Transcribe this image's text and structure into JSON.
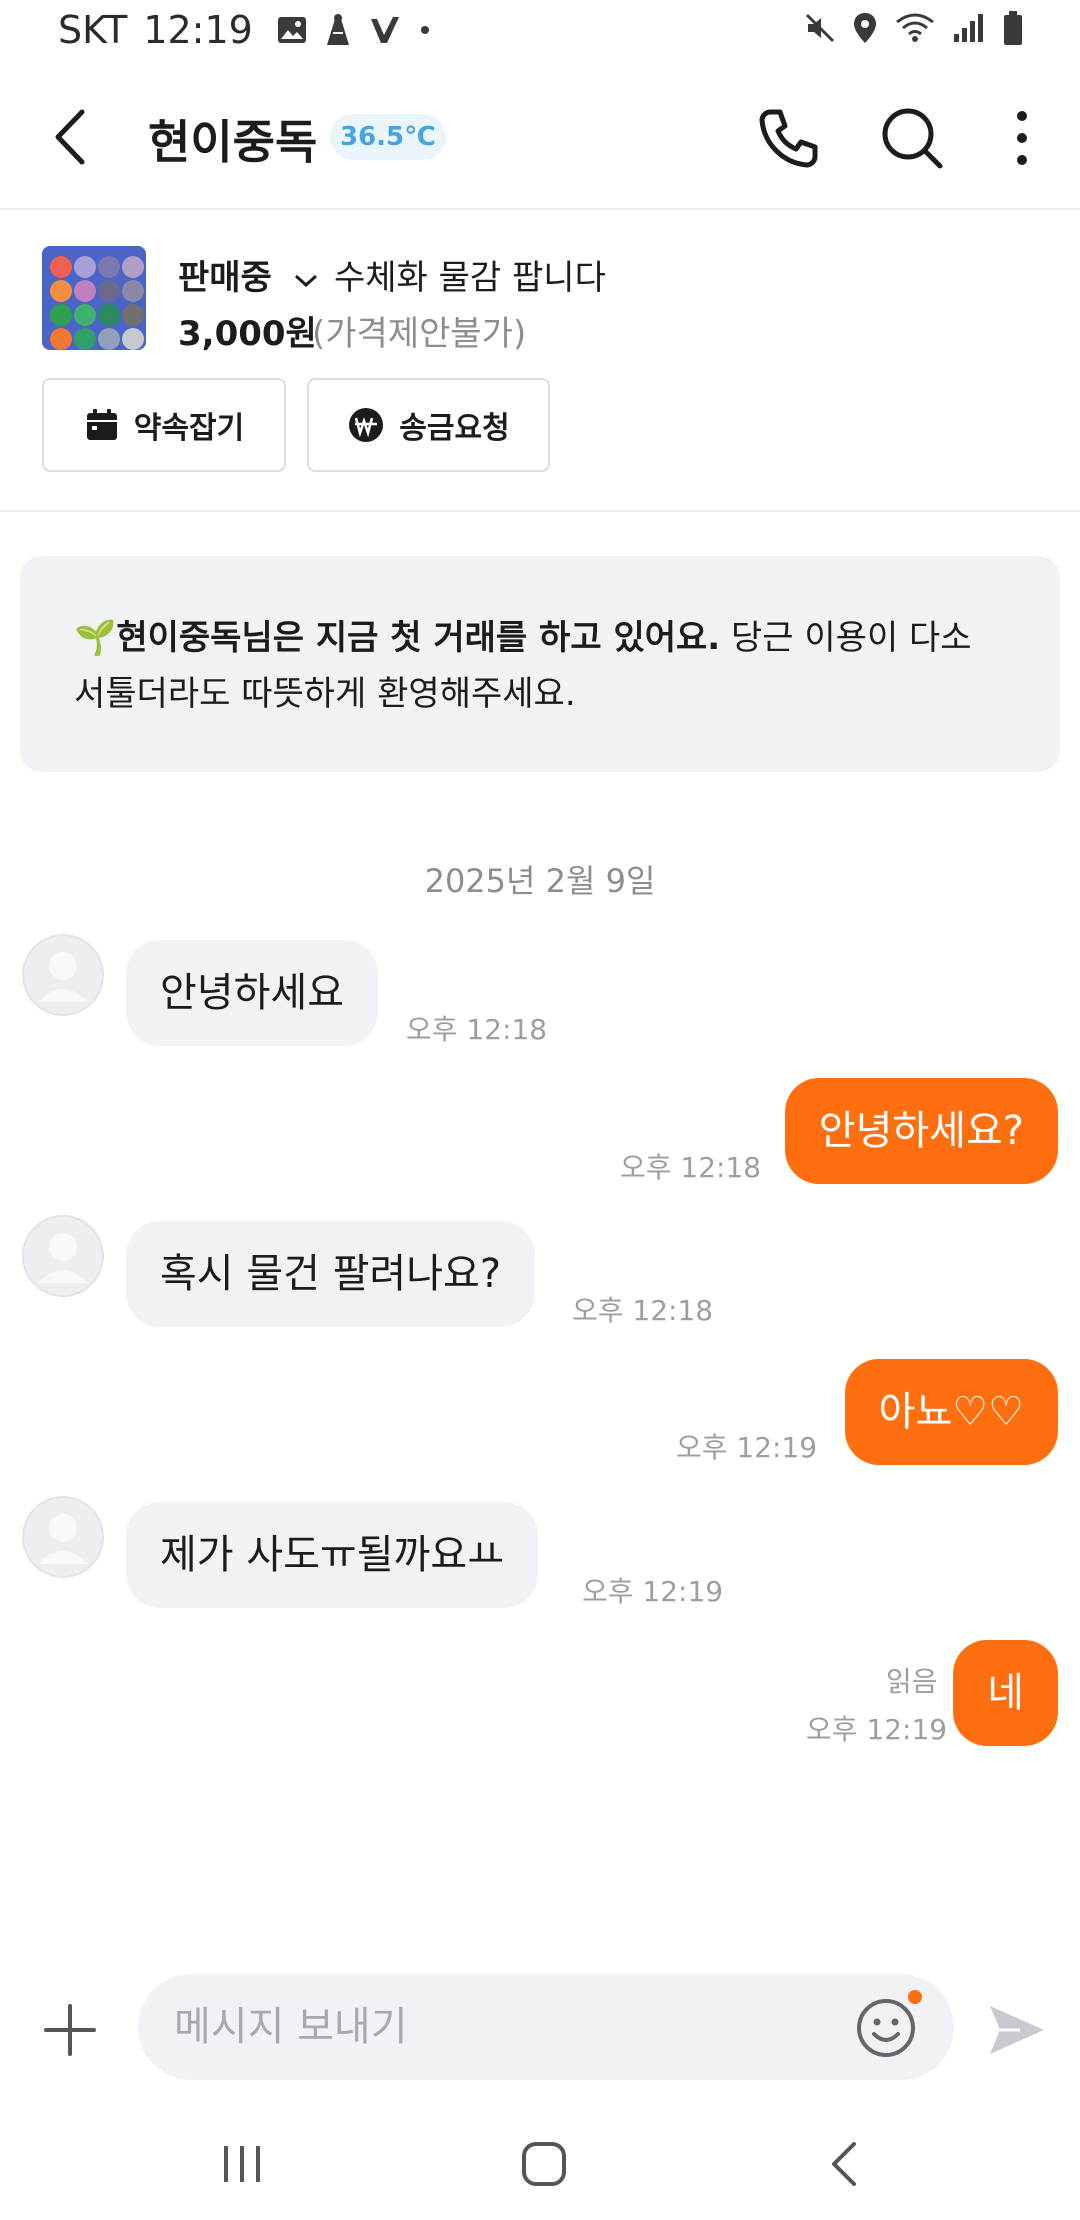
{
  "status_bar": {
    "carrier": "SKT",
    "time": "12:19"
  },
  "header": {
    "title": "현이중독",
    "temperature": "36.5℃"
  },
  "product": {
    "status": "판매중",
    "title": "수체화 물감 팝니다",
    "price": "3,000원",
    "price_note": "(가격제안불가)",
    "appointment_label": "약속잡기",
    "remit_label": "송금요청"
  },
  "notice": {
    "emoji": "🌱",
    "bold_text": "현이중독님은 지금 첫 거래를 하고 있어요.",
    "text": " 당근 이용이 다소 서툴더라도 따뜻하게 환영해주세요."
  },
  "chat": {
    "date": "2025년 2월 9일",
    "messages": [
      {
        "direction": "in",
        "text": "안녕하세요",
        "time": "오후 12:18"
      },
      {
        "direction": "out",
        "text": "안녕하세요?",
        "time": "오후 12:18"
      },
      {
        "direction": "in",
        "text": "혹시 물건 팔려나요?",
        "time": "오후 12:18"
      },
      {
        "direction": "out",
        "text": "아뇨♡♡",
        "time": "오후 12:19"
      },
      {
        "direction": "in",
        "text": "제가 사도ㅠ될까요ㅛ",
        "time": "오후 12:19"
      },
      {
        "direction": "out",
        "text": "네",
        "time": "오후 12:19",
        "read": "읽음"
      }
    ]
  },
  "composer": {
    "placeholder": "메시지 보내기"
  },
  "colors": {
    "accent": "#ff6f0f",
    "bubble_in": "#f1f2f5",
    "temperature": "#46a5e0"
  }
}
